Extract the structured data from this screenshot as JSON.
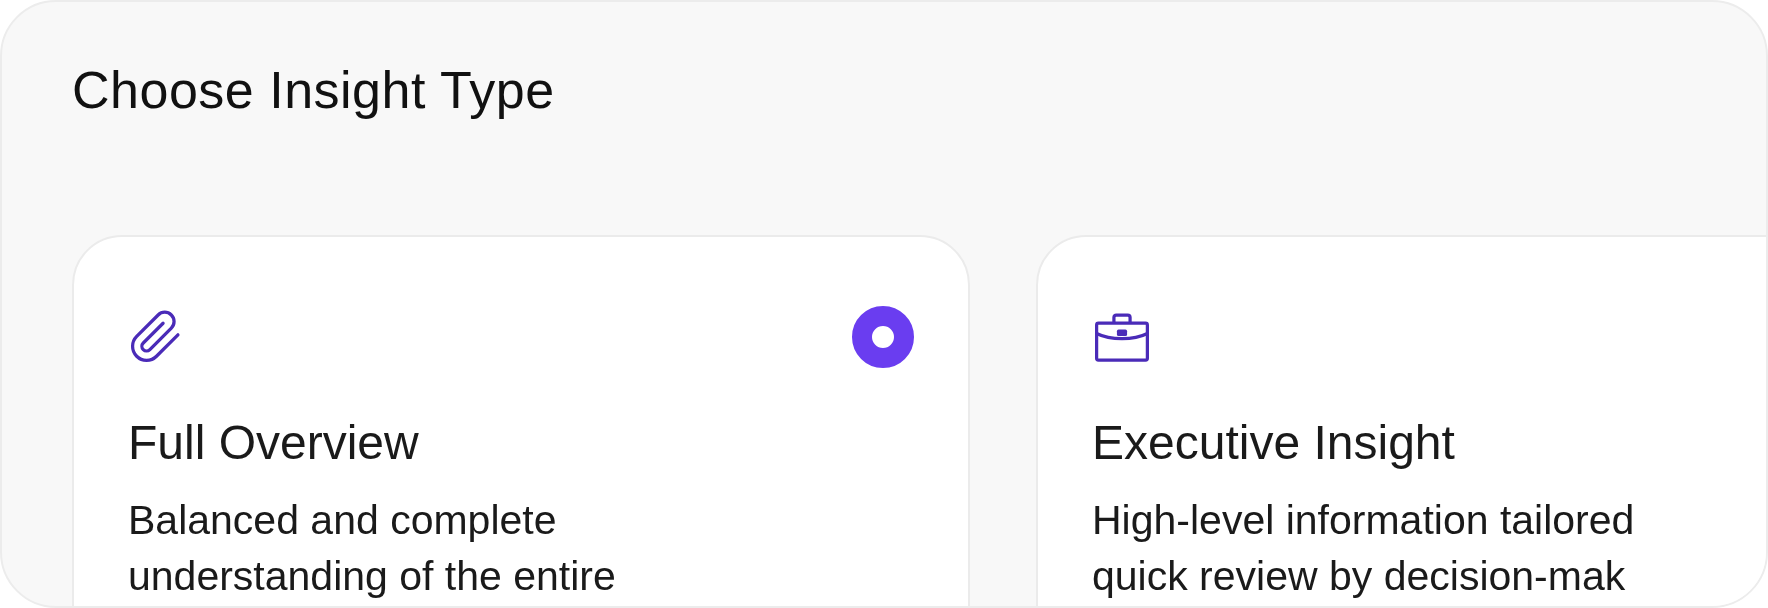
{
  "title": "Choose Insight Type",
  "options": [
    {
      "kind": "paperclip",
      "title": "Full Overview",
      "description": "Balanced and complete understanding of the entire",
      "selected": true
    },
    {
      "kind": "briefcase",
      "title": "Executive Insight",
      "description": "High-level information tailored quick review by decision-mak"
    }
  ]
}
